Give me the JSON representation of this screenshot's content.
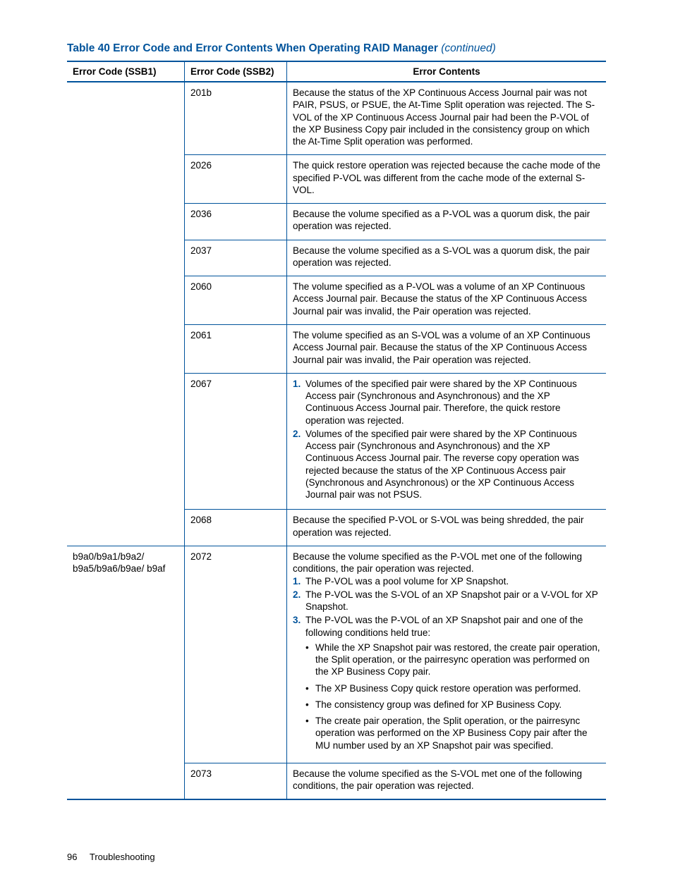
{
  "title_main": "Table 40 Error Code and Error Contents When Operating RAID Manager",
  "title_cont": "(continued)",
  "headers": {
    "ssb1": "Error Code (SSB1)",
    "ssb2": "Error Code (SSB2)",
    "contents": "Error Contents"
  },
  "rows": {
    "r0": {
      "ssb1": "",
      "ssb2": "201b",
      "text": "Because the status of the XP Continuous Access Journal pair was not PAIR, PSUS, or PSUE, the At-Time Split operation was rejected. The S-VOL of the XP Continuous Access Journal pair had been the P-VOL of the XP Business Copy pair included in the consistency group on which the At-Time Split operation was performed."
    },
    "r1": {
      "ssb2": "2026",
      "text": "The quick restore operation was rejected because the cache mode of the specified P-VOL was different from the cache mode of the external S-VOL."
    },
    "r2": {
      "ssb2": "2036",
      "text": "Because the volume specified as a P-VOL was a quorum disk, the pair operation was rejected."
    },
    "r3": {
      "ssb2": "2037",
      "text": "Because the volume specified as a S-VOL was a quorum disk, the pair operation was rejected."
    },
    "r4": {
      "ssb2": "2060",
      "text": "The volume specified as a P-VOL was a volume of an XP Continuous Access Journal pair. Because the status of the XP Continuous Access Journal pair was invalid, the Pair operation was rejected."
    },
    "r5": {
      "ssb2": "2061",
      "text": "The volume specified as an S-VOL was a volume of an XP Continuous Access Journal pair. Because the status of the XP Continuous Access Journal pair was invalid, the Pair operation was rejected."
    },
    "r6": {
      "ssb2": "2067",
      "li1": "Volumes of the specified pair were shared by the XP Continuous Access pair (Synchronous and Asynchronous) and the XP Continuous Access Journal pair. Therefore, the quick restore operation was rejected.",
      "li2": "Volumes of the specified pair were shared by the XP Continuous Access pair (Synchronous and Asynchronous) and the XP Continuous Access Journal pair. The reverse copy operation was rejected because the status of the XP Continuous Access pair (Synchronous and Asynchronous) or the XP Continuous Access Journal pair was not PSUS."
    },
    "r7": {
      "ssb2": "2068",
      "text": "Because the specified P-VOL or S-VOL was being shredded, the pair operation was rejected."
    },
    "r8": {
      "ssb1": "b9a0/b9a1/b9a2/ b9a5/b9a6/b9ae/ b9af",
      "ssb2": "2072",
      "intro": "Because the volume specified as the P-VOL met one of the following conditions, the pair operation was rejected.",
      "li1": "The P-VOL was a pool volume for XP Snapshot.",
      "li2": "The P-VOL was the S-VOL of an XP Snapshot pair or a V-VOL for XP Snapshot.",
      "li3": "The P-VOL was the P-VOL of an XP Snapshot pair and one of the following conditions held true:",
      "b1": "While the XP Snapshot pair was restored, the create pair operation, the Split operation, or the pairresync operation was performed on the XP Business Copy pair.",
      "b2": "The XP Business Copy quick restore operation was performed.",
      "b3": "The consistency group was defined for XP Business Copy.",
      "b4": "The create pair operation, the Split operation, or the pairresync operation was performed on the XP Business Copy pair after the MU number used by an XP Snapshot pair was specified."
    },
    "r9": {
      "ssb2": "2073",
      "text": "Because the volume specified as the S-VOL met one of the following conditions, the pair operation was rejected."
    }
  },
  "footer": {
    "page": "96",
    "section": "Troubleshooting"
  }
}
